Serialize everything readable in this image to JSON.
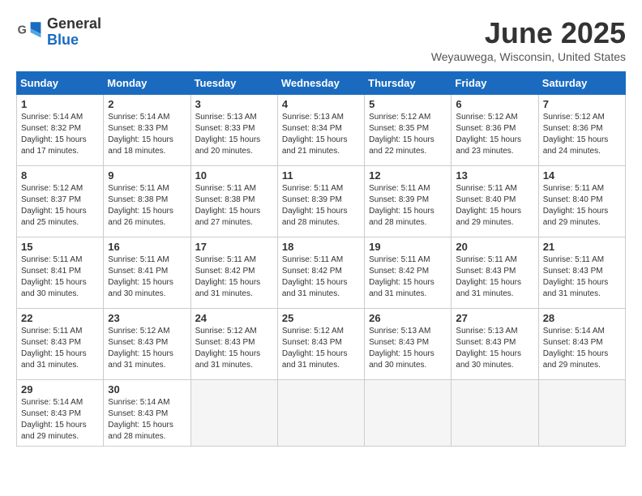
{
  "logo": {
    "general": "General",
    "blue": "Blue"
  },
  "title": "June 2025",
  "location": "Weyauwega, Wisconsin, United States",
  "headers": [
    "Sunday",
    "Monday",
    "Tuesday",
    "Wednesday",
    "Thursday",
    "Friday",
    "Saturday"
  ],
  "weeks": [
    [
      {
        "day": "1",
        "info": "Sunrise: 5:14 AM\nSunset: 8:32 PM\nDaylight: 15 hours\nand 17 minutes."
      },
      {
        "day": "2",
        "info": "Sunrise: 5:14 AM\nSunset: 8:33 PM\nDaylight: 15 hours\nand 18 minutes."
      },
      {
        "day": "3",
        "info": "Sunrise: 5:13 AM\nSunset: 8:33 PM\nDaylight: 15 hours\nand 20 minutes."
      },
      {
        "day": "4",
        "info": "Sunrise: 5:13 AM\nSunset: 8:34 PM\nDaylight: 15 hours\nand 21 minutes."
      },
      {
        "day": "5",
        "info": "Sunrise: 5:12 AM\nSunset: 8:35 PM\nDaylight: 15 hours\nand 22 minutes."
      },
      {
        "day": "6",
        "info": "Sunrise: 5:12 AM\nSunset: 8:36 PM\nDaylight: 15 hours\nand 23 minutes."
      },
      {
        "day": "7",
        "info": "Sunrise: 5:12 AM\nSunset: 8:36 PM\nDaylight: 15 hours\nand 24 minutes."
      }
    ],
    [
      {
        "day": "8",
        "info": "Sunrise: 5:12 AM\nSunset: 8:37 PM\nDaylight: 15 hours\nand 25 minutes."
      },
      {
        "day": "9",
        "info": "Sunrise: 5:11 AM\nSunset: 8:38 PM\nDaylight: 15 hours\nand 26 minutes."
      },
      {
        "day": "10",
        "info": "Sunrise: 5:11 AM\nSunset: 8:38 PM\nDaylight: 15 hours\nand 27 minutes."
      },
      {
        "day": "11",
        "info": "Sunrise: 5:11 AM\nSunset: 8:39 PM\nDaylight: 15 hours\nand 28 minutes."
      },
      {
        "day": "12",
        "info": "Sunrise: 5:11 AM\nSunset: 8:39 PM\nDaylight: 15 hours\nand 28 minutes."
      },
      {
        "day": "13",
        "info": "Sunrise: 5:11 AM\nSunset: 8:40 PM\nDaylight: 15 hours\nand 29 minutes."
      },
      {
        "day": "14",
        "info": "Sunrise: 5:11 AM\nSunset: 8:40 PM\nDaylight: 15 hours\nand 29 minutes."
      }
    ],
    [
      {
        "day": "15",
        "info": "Sunrise: 5:11 AM\nSunset: 8:41 PM\nDaylight: 15 hours\nand 30 minutes."
      },
      {
        "day": "16",
        "info": "Sunrise: 5:11 AM\nSunset: 8:41 PM\nDaylight: 15 hours\nand 30 minutes."
      },
      {
        "day": "17",
        "info": "Sunrise: 5:11 AM\nSunset: 8:42 PM\nDaylight: 15 hours\nand 31 minutes."
      },
      {
        "day": "18",
        "info": "Sunrise: 5:11 AM\nSunset: 8:42 PM\nDaylight: 15 hours\nand 31 minutes."
      },
      {
        "day": "19",
        "info": "Sunrise: 5:11 AM\nSunset: 8:42 PM\nDaylight: 15 hours\nand 31 minutes."
      },
      {
        "day": "20",
        "info": "Sunrise: 5:11 AM\nSunset: 8:43 PM\nDaylight: 15 hours\nand 31 minutes."
      },
      {
        "day": "21",
        "info": "Sunrise: 5:11 AM\nSunset: 8:43 PM\nDaylight: 15 hours\nand 31 minutes."
      }
    ],
    [
      {
        "day": "22",
        "info": "Sunrise: 5:11 AM\nSunset: 8:43 PM\nDaylight: 15 hours\nand 31 minutes."
      },
      {
        "day": "23",
        "info": "Sunrise: 5:12 AM\nSunset: 8:43 PM\nDaylight: 15 hours\nand 31 minutes."
      },
      {
        "day": "24",
        "info": "Sunrise: 5:12 AM\nSunset: 8:43 PM\nDaylight: 15 hours\nand 31 minutes."
      },
      {
        "day": "25",
        "info": "Sunrise: 5:12 AM\nSunset: 8:43 PM\nDaylight: 15 hours\nand 31 minutes."
      },
      {
        "day": "26",
        "info": "Sunrise: 5:13 AM\nSunset: 8:43 PM\nDaylight: 15 hours\nand 30 minutes."
      },
      {
        "day": "27",
        "info": "Sunrise: 5:13 AM\nSunset: 8:43 PM\nDaylight: 15 hours\nand 30 minutes."
      },
      {
        "day": "28",
        "info": "Sunrise: 5:14 AM\nSunset: 8:43 PM\nDaylight: 15 hours\nand 29 minutes."
      }
    ],
    [
      {
        "day": "29",
        "info": "Sunrise: 5:14 AM\nSunset: 8:43 PM\nDaylight: 15 hours\nand 29 minutes."
      },
      {
        "day": "30",
        "info": "Sunrise: 5:14 AM\nSunset: 8:43 PM\nDaylight: 15 hours\nand 28 minutes."
      },
      null,
      null,
      null,
      null,
      null
    ]
  ]
}
